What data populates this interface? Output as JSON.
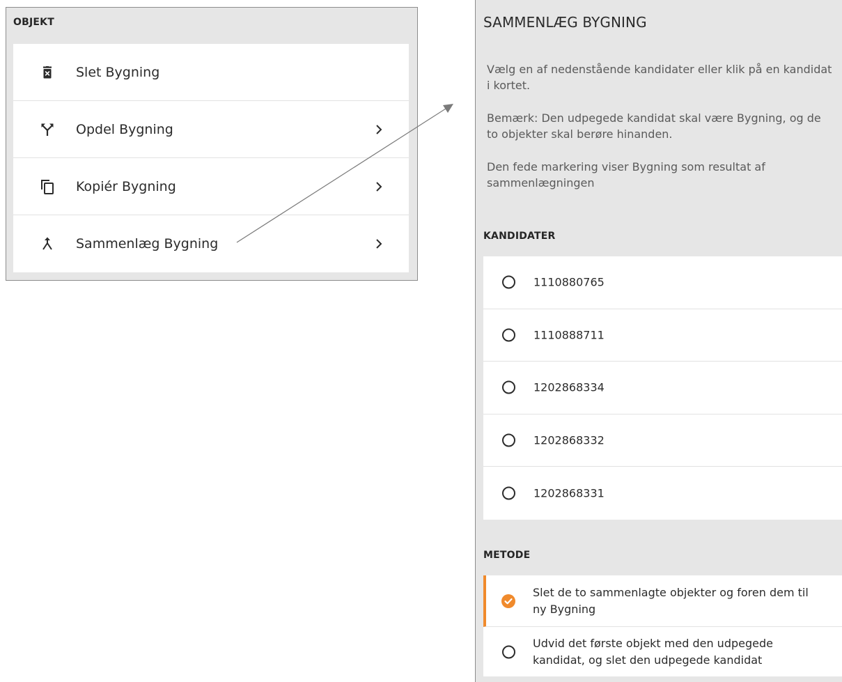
{
  "left_panel": {
    "header": "OBJEKT",
    "items": [
      {
        "label": "Slet Bygning",
        "icon": "trash-icon",
        "has_chevron": false
      },
      {
        "label": "Opdel Bygning",
        "icon": "split-icon",
        "has_chevron": true
      },
      {
        "label": "Kopiér Bygning",
        "icon": "copy-icon",
        "has_chevron": true
      },
      {
        "label": "Sammenlæg Bygning",
        "icon": "merge-icon",
        "has_chevron": true
      }
    ]
  },
  "right_panel": {
    "title": "SAMMENLÆG BYGNING",
    "paragraphs": [
      "Vælg en af nedenstående kandidater eller klik på en kandidat i kortet.",
      "Bemærk: Den udpegede kandidat skal være Bygning, og de to objekter skal berøre hinanden.",
      "Den fede markering viser Bygning som resultat af sammenlægningen"
    ],
    "candidates_header": "KANDIDATER",
    "candidates": [
      "1110880765",
      "1110888711",
      "1202868334",
      "1202868332",
      "1202868331"
    ],
    "method_header": "METODE",
    "methods": [
      {
        "label": "Slet de to sammenlagte objekter og foren dem til ny Bygning",
        "selected": true
      },
      {
        "label": "Udvid det første objekt med den udpegede kandidat, og slet den udpegede kandidat",
        "selected": false
      }
    ]
  },
  "colors": {
    "accent": "#f08a2c",
    "panel_bg": "#e6e6e6",
    "item_bg": "#ffffff",
    "text": "#2b2b2b",
    "muted_text": "#5a5a5a"
  }
}
